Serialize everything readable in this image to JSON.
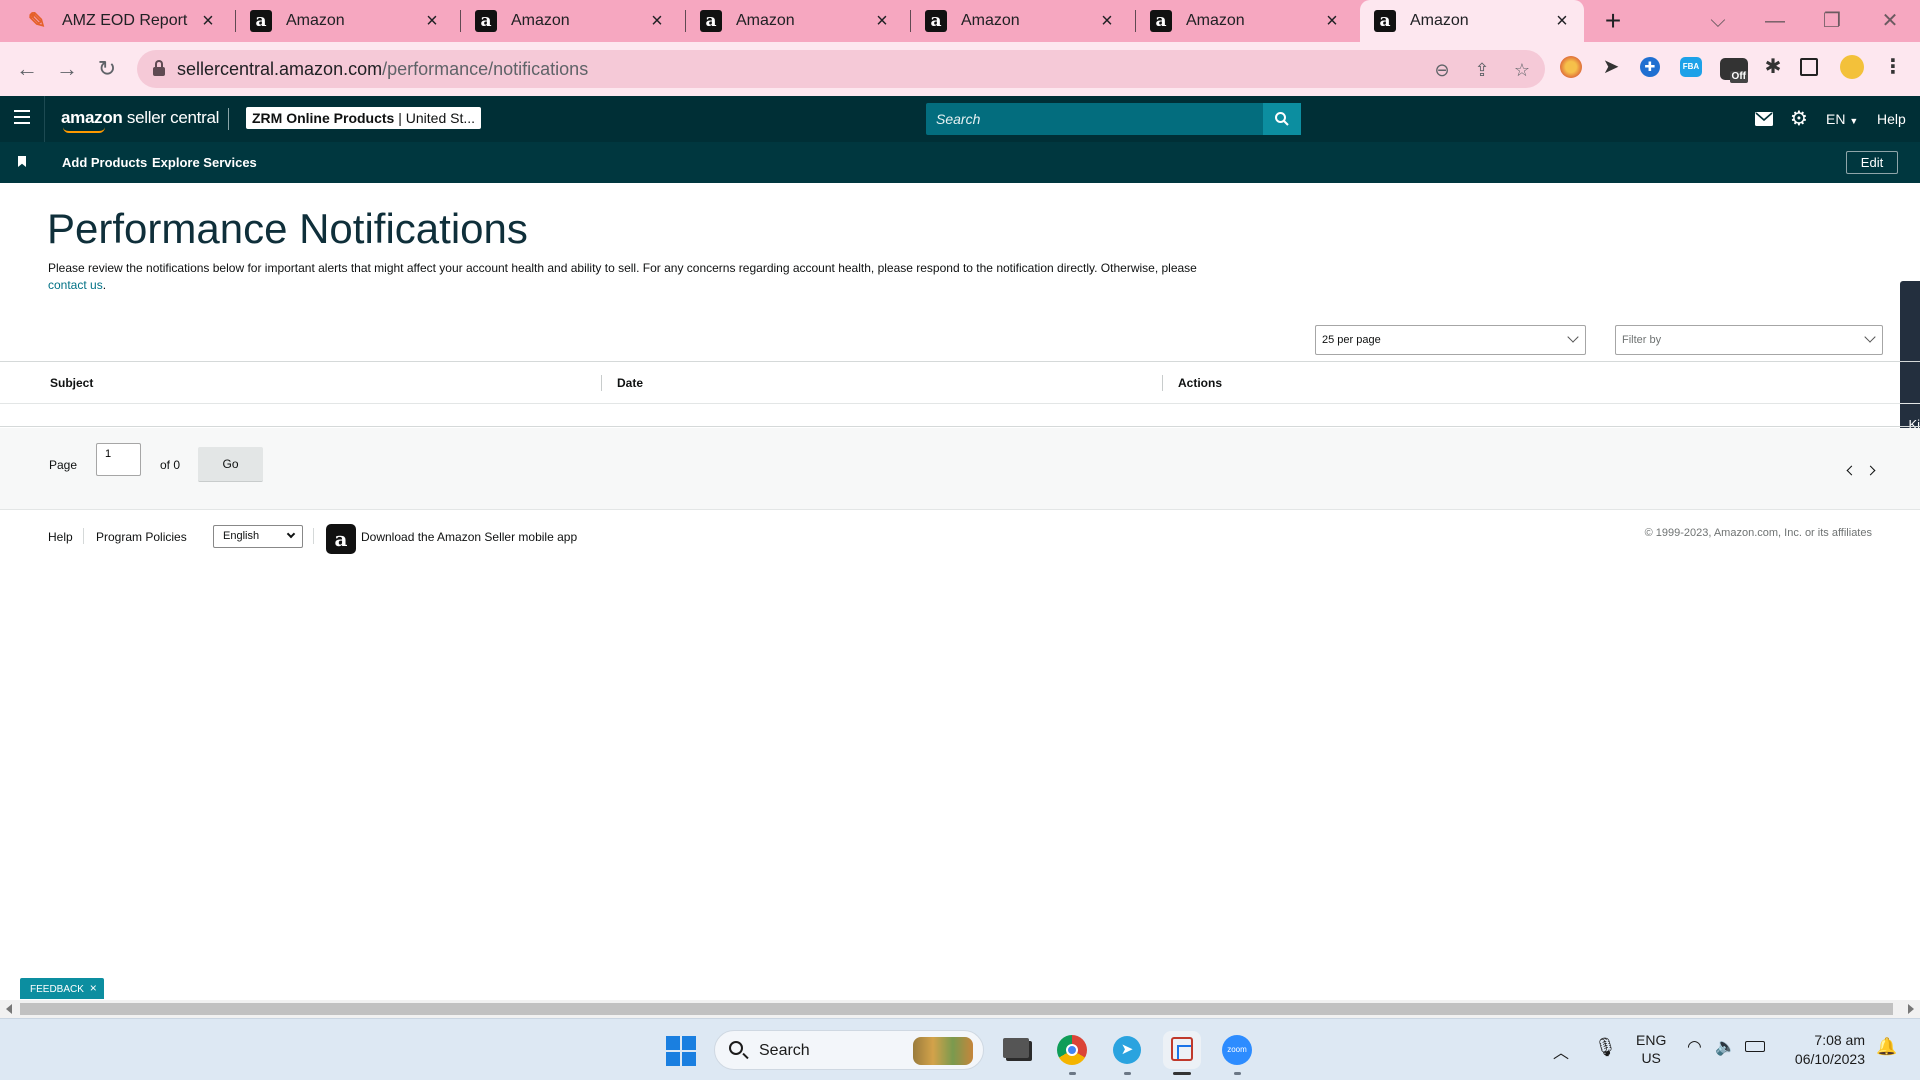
{
  "browser": {
    "tabs": [
      {
        "title": "AMZ EOD Report",
        "active": false,
        "favicon": "eod-report-icon"
      },
      {
        "title": "Amazon",
        "active": false,
        "favicon": "amazon-a-icon"
      },
      {
        "title": "Amazon",
        "active": false,
        "favicon": "amazon-a-icon"
      },
      {
        "title": "Amazon",
        "active": false,
        "favicon": "amazon-a-icon"
      },
      {
        "title": "Amazon",
        "active": false,
        "favicon": "amazon-a-icon"
      },
      {
        "title": "Amazon",
        "active": false,
        "favicon": "amazon-a-icon"
      },
      {
        "title": "Amazon",
        "active": true,
        "favicon": "amazon-a-icon"
      }
    ],
    "url_host": "sellercentral.amazon.com",
    "url_path": "/performance/notifications",
    "extension_off_badge": "Off",
    "extension_fba_label": "FBA"
  },
  "header": {
    "logo_bold": "amazon",
    "logo_rest": " seller central",
    "store_name": "ZRM Online Products",
    "store_region": "United St...",
    "search_placeholder": "Search",
    "language": "EN",
    "help": "Help"
  },
  "subnav": {
    "links": [
      "Add Products",
      "Explore Services"
    ],
    "edit_label": "Edit"
  },
  "page": {
    "title": "Performance Notifications",
    "description": "Please review the notifications below for important alerts that might affect your account health and ability to sell. For any concerns regarding account health, please respond to the notification directly. Otherwise, please",
    "contact_link": "contact us",
    "contact_suffix": ".",
    "side_tab_label": "Ki",
    "per_page_select": "25 per page",
    "filter_placeholder": "Filter by",
    "table_columns": [
      "Subject",
      "Date",
      "Actions"
    ],
    "pagination": {
      "page_label": "Page",
      "current_page": "1",
      "of_label": "of 0",
      "go_label": "Go"
    }
  },
  "footer": {
    "help": "Help",
    "program_policies": "Program Policies",
    "language_select": "English",
    "app_link": "Download the Amazon Seller mobile app",
    "copyright": "© 1999-2023, Amazon.com, Inc. or its affiliates"
  },
  "feedback": {
    "label": "FEEDBACK",
    "close": "×"
  },
  "taskbar": {
    "search_label": "Search",
    "lang_line1": "ENG",
    "lang_line2": "US",
    "time": "7:08 am",
    "date": "06/10/2023",
    "zoom_label": "zoom"
  }
}
